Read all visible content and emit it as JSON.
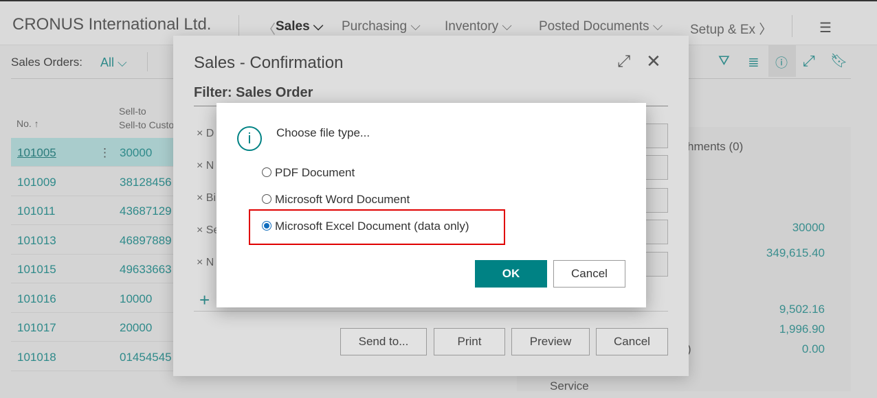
{
  "app": {
    "company": "CRONUS International Ltd.",
    "nav": [
      "Sales",
      "Purchasing",
      "Inventory",
      "Posted Documents",
      "Setup & Ex"
    ]
  },
  "list": {
    "title": "Sales Orders:",
    "filter": "All",
    "col_no": "No. ↑",
    "col_customer": "Sell-to Customer N",
    "rows": [
      [
        "101005",
        "30000"
      ],
      [
        "101009",
        "38128456"
      ],
      [
        "101011",
        "43687129"
      ],
      [
        "101013",
        "46897889"
      ],
      [
        "101015",
        "49633663"
      ],
      [
        "101016",
        "10000"
      ],
      [
        "101017",
        "20000"
      ],
      [
        "101018",
        "01454545"
      ]
    ]
  },
  "factbox": {
    "attachments": "hments (0)",
    "values": [
      "30000",
      "349,615.40",
      "9,502.16",
      "1,996.90",
      "0.00"
    ],
    "paren": ")",
    "service": "Service"
  },
  "report_dialog": {
    "title": "Sales - Confirmation",
    "filter_title": "Filter: Sales Order",
    "filter_letters": [
      "D",
      "N",
      "Bi",
      "Se",
      "N"
    ],
    "buttons": [
      "Send to...",
      "Print",
      "Preview",
      "Cancel"
    ]
  },
  "file_dialog": {
    "message": "Choose file type...",
    "options": [
      {
        "label": "PDF Document",
        "selected": false
      },
      {
        "label": "Microsoft Word Document",
        "selected": false
      },
      {
        "label": "Microsoft Excel Document (data only)",
        "selected": true
      }
    ],
    "ok": "OK",
    "cancel": "Cancel"
  },
  "colors": {
    "accent": "#008284",
    "highlight": "#e00000",
    "link": "#2f8a8a"
  }
}
